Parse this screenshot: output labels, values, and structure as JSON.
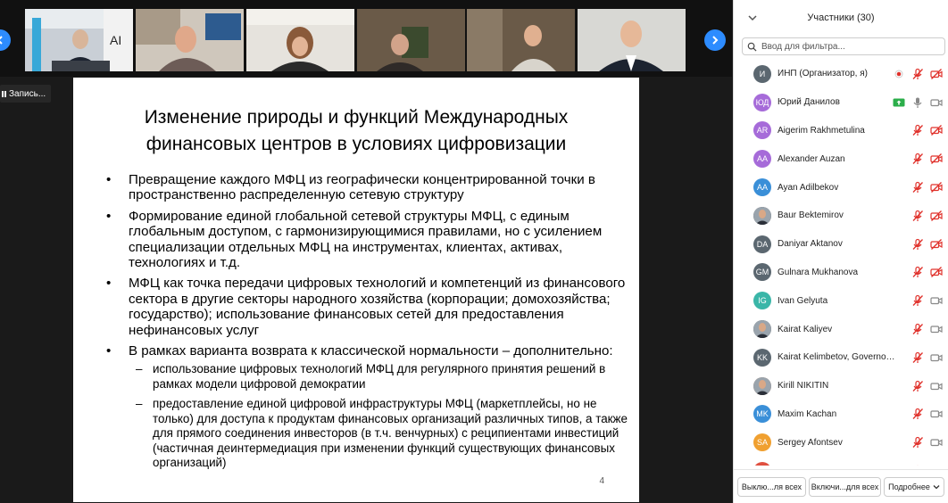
{
  "window": {
    "recording_label": "Запись..."
  },
  "slide": {
    "title_line1": "Изменение природы и функций Международных",
    "title_line2": "финансовых центров в условиях цифровизации",
    "bullets": [
      "Превращение каждого МФЦ из географически концентрированной точки в пространственно распределенную сетевую структуру",
      "Формирование единой глобальной сетевой структуры МФЦ, с единым глобальным доступом, с гармонизирующимися правилами, но с усилением специализации отдельных МФЦ на инструментах, клиентах, активах, технологиях и т.д.",
      "МФЦ как точка передачи цифровых технологий и компетенций из финансового сектора в другие секторы народного хозяйства (корпорации; домохозяйства; государство); использование финансовых сетей для предоставления нефинансовых услуг",
      "В рамках варианта возврата к классической нормальности – дополнительно:"
    ],
    "sub_bullets": [
      "использование цифровых технологий МФЦ для регулярного принятия решений в рамках модели цифровой демократии",
      "предоставление единой цифровой инфраструктуры МФЦ (маркетплейсы, но не только) для доступа к продуктам финансовых организаций различных типов, а также для прямого соединения инвесторов (в т.ч. венчурных) с реципиентами инвестиций (частичная деинтермедиация при изменении функций существующих финансовых организаций)"
    ],
    "page_number": "4"
  },
  "participants_panel": {
    "title": "Участники (30)",
    "filter_placeholder": "Ввод для фильтра...",
    "participants": [
      {
        "initials": "И",
        "name": "ИНП (Организатор, я)",
        "avatar_color": "#5b6770",
        "mic": "muted",
        "video": "off",
        "recording": true
      },
      {
        "initials": "ЮД",
        "name": "Юрий Данилов",
        "avatar_color": "#a66bd9",
        "mic": "on",
        "video": "on",
        "share": true
      },
      {
        "initials": "AR",
        "name": "Aigerim Rakhmetulina",
        "avatar_color": "#a66bd9",
        "mic": "muted",
        "video": "off"
      },
      {
        "initials": "AA",
        "name": "Alexander Auzan",
        "avatar_color": "#a66bd9",
        "mic": "muted",
        "video": "off"
      },
      {
        "initials": "AA",
        "name": "Ayan Adilbekov",
        "avatar_color": "#3a8fd8",
        "mic": "muted",
        "video": "off"
      },
      {
        "initials": "",
        "name": "Baur Bektemirov",
        "avatar_color": "#4a4a4a",
        "photo": true,
        "mic": "muted",
        "video": "off"
      },
      {
        "initials": "DA",
        "name": "Daniyar Aktanov",
        "avatar_color": "#5b6770",
        "mic": "muted",
        "video": "off"
      },
      {
        "initials": "GM",
        "name": "Gulnara Mukhanova",
        "avatar_color": "#5b6770",
        "mic": "muted",
        "video": "off"
      },
      {
        "initials": "IG",
        "name": "Ivan Gelyuta",
        "avatar_color": "#3ab6a8",
        "mic": "muted",
        "video": "on"
      },
      {
        "initials": "",
        "name": "Kairat Kaliyev",
        "avatar_color": "#4a4a4a",
        "photo": true,
        "mic": "muted",
        "video": "on"
      },
      {
        "initials": "KK",
        "name": "Kairat Kelimbetov, Governor...",
        "avatar_color": "#5b6770",
        "mic": "muted",
        "video": "on"
      },
      {
        "initials": "",
        "name": "Kirill NIKITIN",
        "avatar_color": "#b07050",
        "photo": true,
        "mic": "muted",
        "video": "on"
      },
      {
        "initials": "MK",
        "name": "Maxim Kachan",
        "avatar_color": "#3a8fd8",
        "mic": "muted",
        "video": "on"
      },
      {
        "initials": "SA",
        "name": "Sergey Afontsev",
        "avatar_color": "#f0a030",
        "mic": "muted",
        "video": "on"
      },
      {
        "initials": "",
        "name": "",
        "avatar_color": "#e05040",
        "mic": "muted",
        "video": "off"
      }
    ],
    "footer": {
      "mute_all": "Выклю...ля всех",
      "unmute_all": "Включи...для всех",
      "more": "Подробнее"
    }
  },
  "colors": {
    "accent": "#2d8cff",
    "muted_red": "#e0312b"
  }
}
